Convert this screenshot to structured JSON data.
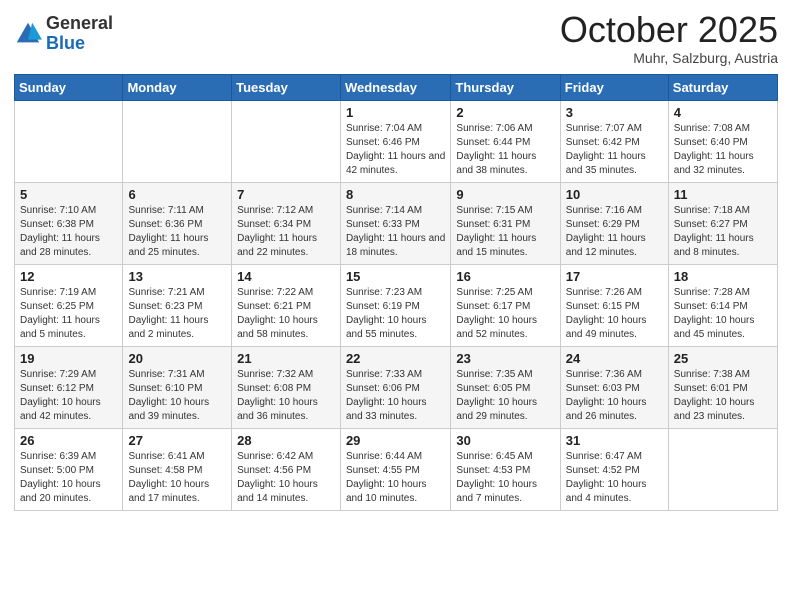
{
  "header": {
    "logo_general": "General",
    "logo_blue": "Blue",
    "month": "October 2025",
    "location": "Muhr, Salzburg, Austria"
  },
  "days_of_week": [
    "Sunday",
    "Monday",
    "Tuesday",
    "Wednesday",
    "Thursday",
    "Friday",
    "Saturday"
  ],
  "weeks": [
    [
      {
        "day": "",
        "info": ""
      },
      {
        "day": "",
        "info": ""
      },
      {
        "day": "",
        "info": ""
      },
      {
        "day": "1",
        "info": "Sunrise: 7:04 AM\nSunset: 6:46 PM\nDaylight: 11 hours and 42 minutes."
      },
      {
        "day": "2",
        "info": "Sunrise: 7:06 AM\nSunset: 6:44 PM\nDaylight: 11 hours and 38 minutes."
      },
      {
        "day": "3",
        "info": "Sunrise: 7:07 AM\nSunset: 6:42 PM\nDaylight: 11 hours and 35 minutes."
      },
      {
        "day": "4",
        "info": "Sunrise: 7:08 AM\nSunset: 6:40 PM\nDaylight: 11 hours and 32 minutes."
      }
    ],
    [
      {
        "day": "5",
        "info": "Sunrise: 7:10 AM\nSunset: 6:38 PM\nDaylight: 11 hours and 28 minutes."
      },
      {
        "day": "6",
        "info": "Sunrise: 7:11 AM\nSunset: 6:36 PM\nDaylight: 11 hours and 25 minutes."
      },
      {
        "day": "7",
        "info": "Sunrise: 7:12 AM\nSunset: 6:34 PM\nDaylight: 11 hours and 22 minutes."
      },
      {
        "day": "8",
        "info": "Sunrise: 7:14 AM\nSunset: 6:33 PM\nDaylight: 11 hours and 18 minutes."
      },
      {
        "day": "9",
        "info": "Sunrise: 7:15 AM\nSunset: 6:31 PM\nDaylight: 11 hours and 15 minutes."
      },
      {
        "day": "10",
        "info": "Sunrise: 7:16 AM\nSunset: 6:29 PM\nDaylight: 11 hours and 12 minutes."
      },
      {
        "day": "11",
        "info": "Sunrise: 7:18 AM\nSunset: 6:27 PM\nDaylight: 11 hours and 8 minutes."
      }
    ],
    [
      {
        "day": "12",
        "info": "Sunrise: 7:19 AM\nSunset: 6:25 PM\nDaylight: 11 hours and 5 minutes."
      },
      {
        "day": "13",
        "info": "Sunrise: 7:21 AM\nSunset: 6:23 PM\nDaylight: 11 hours and 2 minutes."
      },
      {
        "day": "14",
        "info": "Sunrise: 7:22 AM\nSunset: 6:21 PM\nDaylight: 10 hours and 58 minutes."
      },
      {
        "day": "15",
        "info": "Sunrise: 7:23 AM\nSunset: 6:19 PM\nDaylight: 10 hours and 55 minutes."
      },
      {
        "day": "16",
        "info": "Sunrise: 7:25 AM\nSunset: 6:17 PM\nDaylight: 10 hours and 52 minutes."
      },
      {
        "day": "17",
        "info": "Sunrise: 7:26 AM\nSunset: 6:15 PM\nDaylight: 10 hours and 49 minutes."
      },
      {
        "day": "18",
        "info": "Sunrise: 7:28 AM\nSunset: 6:14 PM\nDaylight: 10 hours and 45 minutes."
      }
    ],
    [
      {
        "day": "19",
        "info": "Sunrise: 7:29 AM\nSunset: 6:12 PM\nDaylight: 10 hours and 42 minutes."
      },
      {
        "day": "20",
        "info": "Sunrise: 7:31 AM\nSunset: 6:10 PM\nDaylight: 10 hours and 39 minutes."
      },
      {
        "day": "21",
        "info": "Sunrise: 7:32 AM\nSunset: 6:08 PM\nDaylight: 10 hours and 36 minutes."
      },
      {
        "day": "22",
        "info": "Sunrise: 7:33 AM\nSunset: 6:06 PM\nDaylight: 10 hours and 33 minutes."
      },
      {
        "day": "23",
        "info": "Sunrise: 7:35 AM\nSunset: 6:05 PM\nDaylight: 10 hours and 29 minutes."
      },
      {
        "day": "24",
        "info": "Sunrise: 7:36 AM\nSunset: 6:03 PM\nDaylight: 10 hours and 26 minutes."
      },
      {
        "day": "25",
        "info": "Sunrise: 7:38 AM\nSunset: 6:01 PM\nDaylight: 10 hours and 23 minutes."
      }
    ],
    [
      {
        "day": "26",
        "info": "Sunrise: 6:39 AM\nSunset: 5:00 PM\nDaylight: 10 hours and 20 minutes."
      },
      {
        "day": "27",
        "info": "Sunrise: 6:41 AM\nSunset: 4:58 PM\nDaylight: 10 hours and 17 minutes."
      },
      {
        "day": "28",
        "info": "Sunrise: 6:42 AM\nSunset: 4:56 PM\nDaylight: 10 hours and 14 minutes."
      },
      {
        "day": "29",
        "info": "Sunrise: 6:44 AM\nSunset: 4:55 PM\nDaylight: 10 hours and 10 minutes."
      },
      {
        "day": "30",
        "info": "Sunrise: 6:45 AM\nSunset: 4:53 PM\nDaylight: 10 hours and 7 minutes."
      },
      {
        "day": "31",
        "info": "Sunrise: 6:47 AM\nSunset: 4:52 PM\nDaylight: 10 hours and 4 minutes."
      },
      {
        "day": "",
        "info": ""
      }
    ]
  ]
}
